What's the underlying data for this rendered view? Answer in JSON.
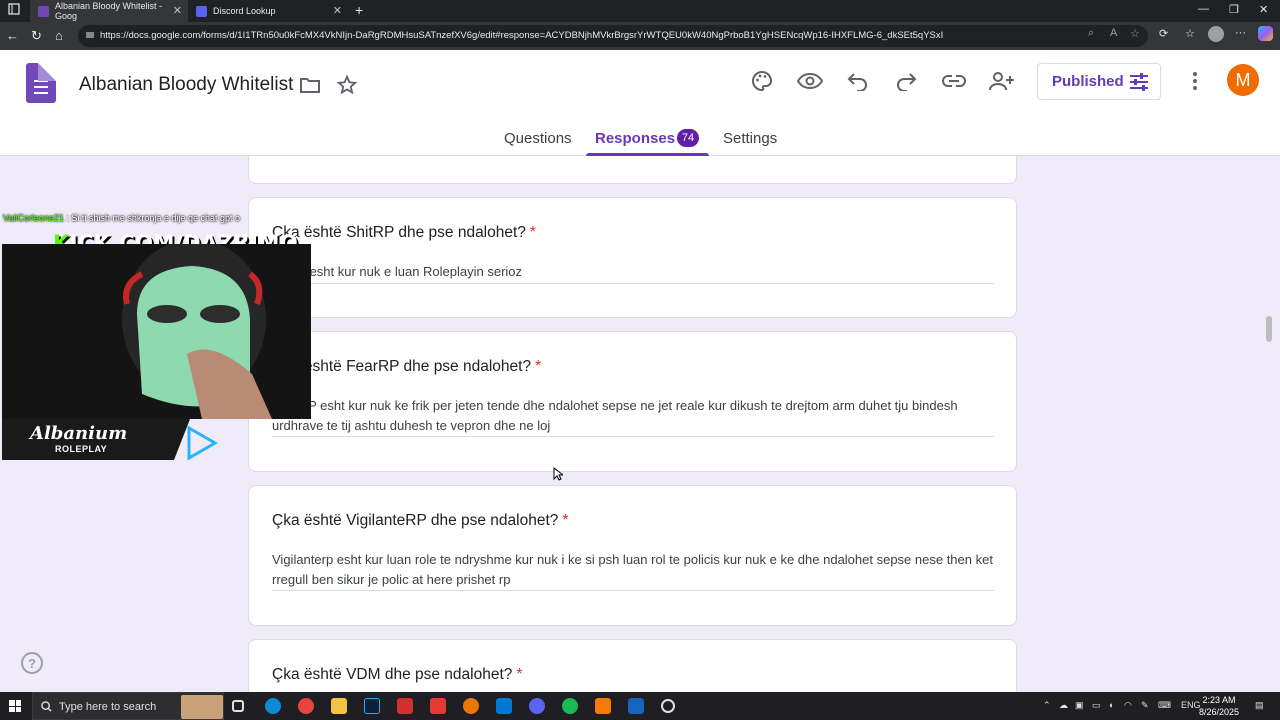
{
  "browser": {
    "tabs": [
      {
        "title": "Albanian Bloody Whitelist - Goog",
        "icon": "google-forms-icon",
        "color": "#7248b9",
        "active": true
      },
      {
        "title": "Discord Lookup",
        "icon": "discord-icon",
        "color": "#5865f2",
        "active": false
      }
    ],
    "url": "https://docs.google.com/forms/d/1I1TRn50u0kFcMX4VkNIjn-DaRgRDMHsuSATnzefXV6g/edit#response=ACYDBNjhMVkrBrgsrYrWTQEU0kW40NgPrboB1YgHSENcqWp16-IHXFLMG-6_dkSEt5qYSxI"
  },
  "form": {
    "title": "Albanian Bloody Whitelist",
    "published_label": "Published",
    "avatar_letter": "M",
    "tabs": {
      "questions": "Questions",
      "responses": "Responses",
      "responses_count": "74",
      "settings": "Settings"
    },
    "accent_color": "#673ab7"
  },
  "responses": [
    {
      "question": "Çka është ShitRP dhe pse ndalohet?",
      "required": "*",
      "answer": "Shitrp esht kur nuk e  luan Roleplayin serioz"
    },
    {
      "question": "Çka është FearRP dhe pse ndalohet?",
      "required": "*",
      "answer": "FearRP esht kur nuk ke  frik per jeten tende dhe ndalohet sepse ne jet reale kur dikush te drejtom arm duhet tju bindesh urdhrave te tij ashtu duhesh te vepron dhe ne loj"
    },
    {
      "question": "Çka është VigilanteRP dhe pse ndalohet?",
      "required": "*",
      "answer": "Vigilanterp esht kur luan role te ndryshme kur nuk i ke si psh luan rol te policis kur nuk e ke dhe ndalohet sepse nese then ket rregull ben sikur je polic at here prishet rp"
    },
    {
      "question": "Çka është VDM dhe pse ndalohet?",
      "required": "*",
      "answer": ""
    }
  ],
  "overlay": {
    "chat_user": "ValiCorleone21",
    "chat_message": "Si ti shish me shkronja e dije qe chat gpt o",
    "kick_k": "K",
    "kick_rest": "ICK.COM/DAZRIMO",
    "rp_logo": "Albanium",
    "rp_sub": "ROLEPLAY"
  },
  "taskbar": {
    "search_placeholder": "Type here to search",
    "language": "ENG",
    "time": "2:23 AM",
    "date": "8/26/2025"
  }
}
